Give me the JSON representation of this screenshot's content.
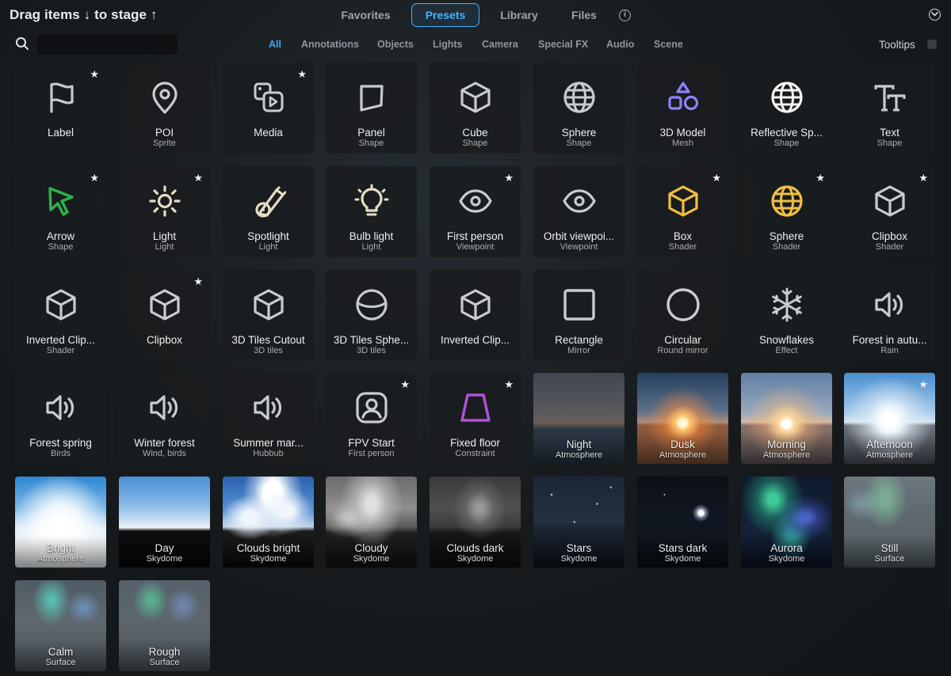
{
  "header": {
    "drag_title": "Drag items ↓ to stage ↑",
    "tabs": [
      {
        "label": "Favorites"
      },
      {
        "label": "Presets"
      },
      {
        "label": "Library"
      },
      {
        "label": "Files"
      }
    ],
    "active_tab": "Presets",
    "info_glyph": "i",
    "accent_color": "#42b3ff"
  },
  "toolbar": {
    "search_placeholder": "",
    "search_value": "",
    "categories": [
      {
        "label": "All"
      },
      {
        "label": "Annotations"
      },
      {
        "label": "Objects"
      },
      {
        "label": "Lights"
      },
      {
        "label": "Camera"
      },
      {
        "label": "Special FX"
      },
      {
        "label": "Audio"
      },
      {
        "label": "Scene"
      }
    ],
    "active_category": "All",
    "tooltips_label": "Tooltips",
    "tooltips_checked": false
  },
  "items": [
    {
      "title": "Label",
      "sub": "",
      "icon": "flag-icon",
      "star": true
    },
    {
      "title": "POI",
      "sub": "Sprite",
      "icon": "map-pin-icon",
      "star": false
    },
    {
      "title": "Media",
      "sub": "",
      "icon": "media-icon",
      "star": true
    },
    {
      "title": "Panel",
      "sub": "Shape",
      "icon": "panel-icon",
      "star": false
    },
    {
      "title": "Cube",
      "sub": "Shape",
      "icon": "cube-icon",
      "star": false
    },
    {
      "title": "Sphere",
      "sub": "Shape",
      "icon": "globe-icon",
      "star": false
    },
    {
      "title": "3D Model",
      "sub": "Mesh",
      "icon": "shapes-icon",
      "star": false,
      "color": "#8a84ff"
    },
    {
      "title": "Reflective Sp...",
      "sub": "Shape",
      "icon": "globe-icon",
      "star": false,
      "color": "#f4f4f4"
    },
    {
      "title": "Text",
      "sub": "Shape",
      "icon": "text-icon",
      "star": false
    },
    {
      "title": "Arrow",
      "sub": "Shape",
      "icon": "cursor-arrow-icon",
      "star": true,
      "color": "#2bb34a"
    },
    {
      "title": "Light",
      "sub": "Light",
      "icon": "sun-icon",
      "star": true,
      "color": "#e5dcc3"
    },
    {
      "title": "Spotlight",
      "sub": "Light",
      "icon": "spotlight-icon",
      "star": false,
      "color": "#e5dcc3"
    },
    {
      "title": "Bulb light",
      "sub": "Light",
      "icon": "bulb-icon",
      "star": false,
      "color": "#e5dcc3"
    },
    {
      "title": "First person",
      "sub": "Viewpoint",
      "icon": "eye-icon",
      "star": true
    },
    {
      "title": "Orbit viewpoi...",
      "sub": "Viewpoint",
      "icon": "eye-icon",
      "star": false
    },
    {
      "title": "Box",
      "sub": "Shader",
      "icon": "cube-icon",
      "star": true,
      "color": "#f0c040"
    },
    {
      "title": "Sphere",
      "sub": "Shader",
      "icon": "globe-icon",
      "star": true,
      "color": "#f0c040"
    },
    {
      "title": "Clipbox",
      "sub": "Shader",
      "icon": "cube-icon",
      "star": true
    },
    {
      "title": "Inverted Clip...",
      "sub": "Shader",
      "icon": "cube-icon",
      "star": false
    },
    {
      "title": "Clipbox",
      "sub": "",
      "icon": "cube-icon",
      "star": true
    },
    {
      "title": "3D Tiles Cutout",
      "sub": "3D tiles",
      "icon": "cube-icon",
      "star": false
    },
    {
      "title": "3D Tiles Sphe...",
      "sub": "3D tiles",
      "icon": "planet-icon",
      "star": false
    },
    {
      "title": "Inverted Clip...",
      "sub": "",
      "icon": "cube-icon",
      "star": false
    },
    {
      "title": "Rectangle",
      "sub": "Mirror",
      "icon": "square-icon",
      "star": false
    },
    {
      "title": "Circular",
      "sub": "Round mirror",
      "icon": "circle-icon",
      "star": false
    },
    {
      "title": "Snowflakes",
      "sub": "Effect",
      "icon": "snowflake-icon",
      "star": false
    },
    {
      "title": "Forest in autu...",
      "sub": "Rain",
      "icon": "speaker-icon",
      "star": false
    },
    {
      "title": "Forest spring",
      "sub": "Birds",
      "icon": "speaker-icon",
      "star": false
    },
    {
      "title": "Winter forest",
      "sub": "Wind, birds",
      "icon": "speaker-icon",
      "star": false
    },
    {
      "title": "Summer mar...",
      "sub": "Hubbub",
      "icon": "speaker-icon",
      "star": false
    },
    {
      "title": "FPV Start",
      "sub": "First person",
      "icon": "user-square-icon",
      "star": true
    },
    {
      "title": "Fixed floor",
      "sub": "Constraint",
      "icon": "trapezoid-icon",
      "star": true,
      "color": "#b44fd8"
    },
    {
      "title": "Night",
      "sub": "Atmosphere",
      "icon": "",
      "star": false,
      "bg": "bg-night"
    },
    {
      "title": "Dusk",
      "sub": "Atmosphere",
      "icon": "",
      "star": false,
      "bg": "bg-dusk"
    },
    {
      "title": "Morning",
      "sub": "Atmosphere",
      "icon": "",
      "star": false,
      "bg": "bg-morning"
    },
    {
      "title": "Afternoon",
      "sub": "Atmosphere",
      "icon": "",
      "star": true,
      "bg": "bg-afternoon"
    },
    {
      "title": "Bright",
      "sub": "Atmosphere",
      "icon": "",
      "star": false,
      "bg": "bg-bright"
    },
    {
      "title": "Day",
      "sub": "Skydome",
      "icon": "",
      "star": false,
      "bg": "bg-day"
    },
    {
      "title": "Clouds bright",
      "sub": "Skydome",
      "icon": "",
      "star": false,
      "bg": "bg-clouds-bright"
    },
    {
      "title": "Cloudy",
      "sub": "Skydome",
      "icon": "",
      "star": false,
      "bg": "bg-cloudy"
    },
    {
      "title": "Clouds dark",
      "sub": "Skydome",
      "icon": "",
      "star": false,
      "bg": "bg-clouds-dark"
    },
    {
      "title": "Stars",
      "sub": "Skydome",
      "icon": "",
      "star": false,
      "bg": "bg-stars"
    },
    {
      "title": "Stars dark",
      "sub": "Skydome",
      "icon": "",
      "star": false,
      "bg": "bg-stars-dark"
    },
    {
      "title": "Aurora",
      "sub": "Skydome",
      "icon": "",
      "star": false,
      "bg": "bg-aurora"
    },
    {
      "title": "Still",
      "sub": "Surface",
      "icon": "",
      "star": false,
      "bg": "bg-still"
    },
    {
      "title": "Calm",
      "sub": "Surface",
      "icon": "",
      "star": false,
      "bg": "bg-calm"
    },
    {
      "title": "Rough",
      "sub": "Surface",
      "icon": "",
      "star": false,
      "bg": "bg-rough"
    }
  ]
}
